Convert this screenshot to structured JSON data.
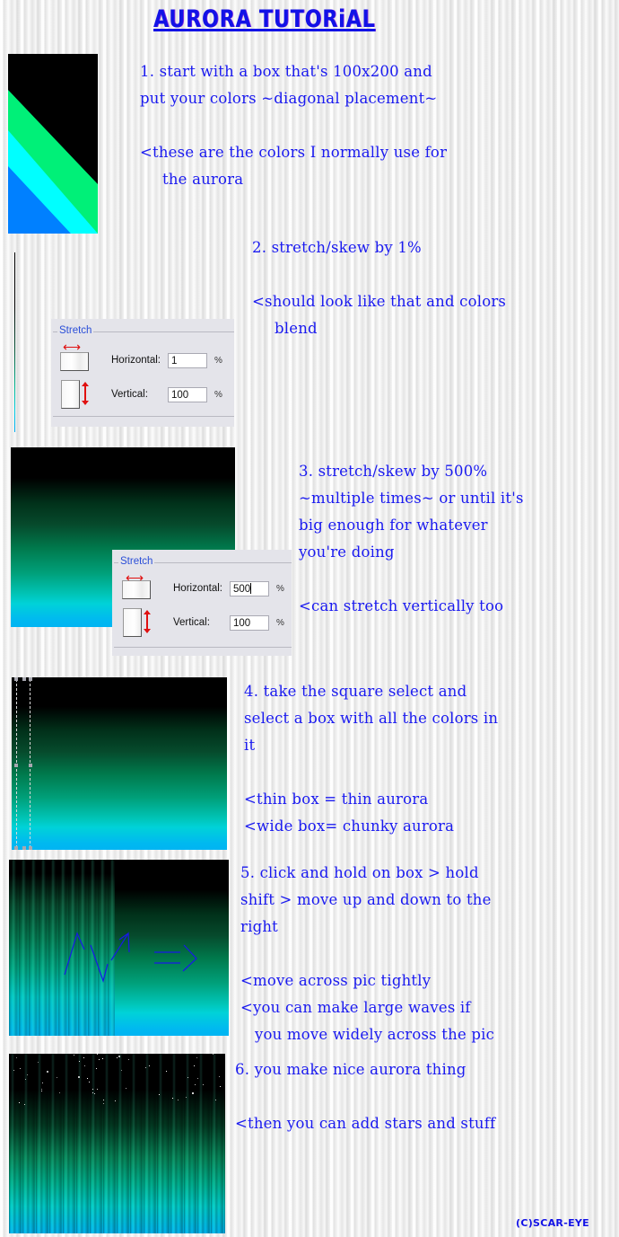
{
  "title": "AURORA TUTORiAL",
  "colors": {
    "text": "#1a1af0",
    "black": "#000000",
    "green": "#00f078",
    "cyan": "#00ffff",
    "blue": "#0080ff"
  },
  "steps": [
    {
      "lines": [
        "1. start with a box that's 100x200 and",
        "put your colors ~diagonal placement~"
      ],
      "notes": [
        "<these are the colors I normally use for",
        "the aurora"
      ]
    },
    {
      "lines": [
        "2. stretch/skew by 1%"
      ],
      "notes": [
        "<should look like that and colors",
        "blend"
      ]
    },
    {
      "lines": [
        "3. stretch/skew by 500%",
        "~multiple times~ or until it's",
        "big enough for whatever",
        "you're doing"
      ],
      "notes": [
        "<can stretch vertically too"
      ]
    },
    {
      "lines": [
        "4. take the square select and",
        "select a box with all the colors in",
        "it"
      ],
      "notes": [
        "<thin box = thin aurora",
        "<wide box= chunky aurora"
      ]
    },
    {
      "lines": [
        "5. click and hold on box > hold",
        "shift > move up and down to the",
        "right"
      ],
      "notes": [
        "<move across pic tightly",
        "<you can make large waves if",
        "you move widely across the pic"
      ]
    },
    {
      "lines": [
        "6. you make nice aurora thing"
      ],
      "notes": [
        "<then you can add stars and stuff"
      ]
    }
  ],
  "dialogs": [
    {
      "group": "Stretch",
      "horizontal_label": "Horizontal:",
      "horizontal_value": "1",
      "vertical_label": "Vertical:",
      "vertical_value": "100",
      "unit": "%"
    },
    {
      "group": "Stretch",
      "horizontal_label": "Horizontal:",
      "horizontal_value": "500",
      "vertical_label": "Vertical:",
      "vertical_value": "100",
      "unit": "%"
    }
  ],
  "copyright": "(C)SCAR-EYE"
}
